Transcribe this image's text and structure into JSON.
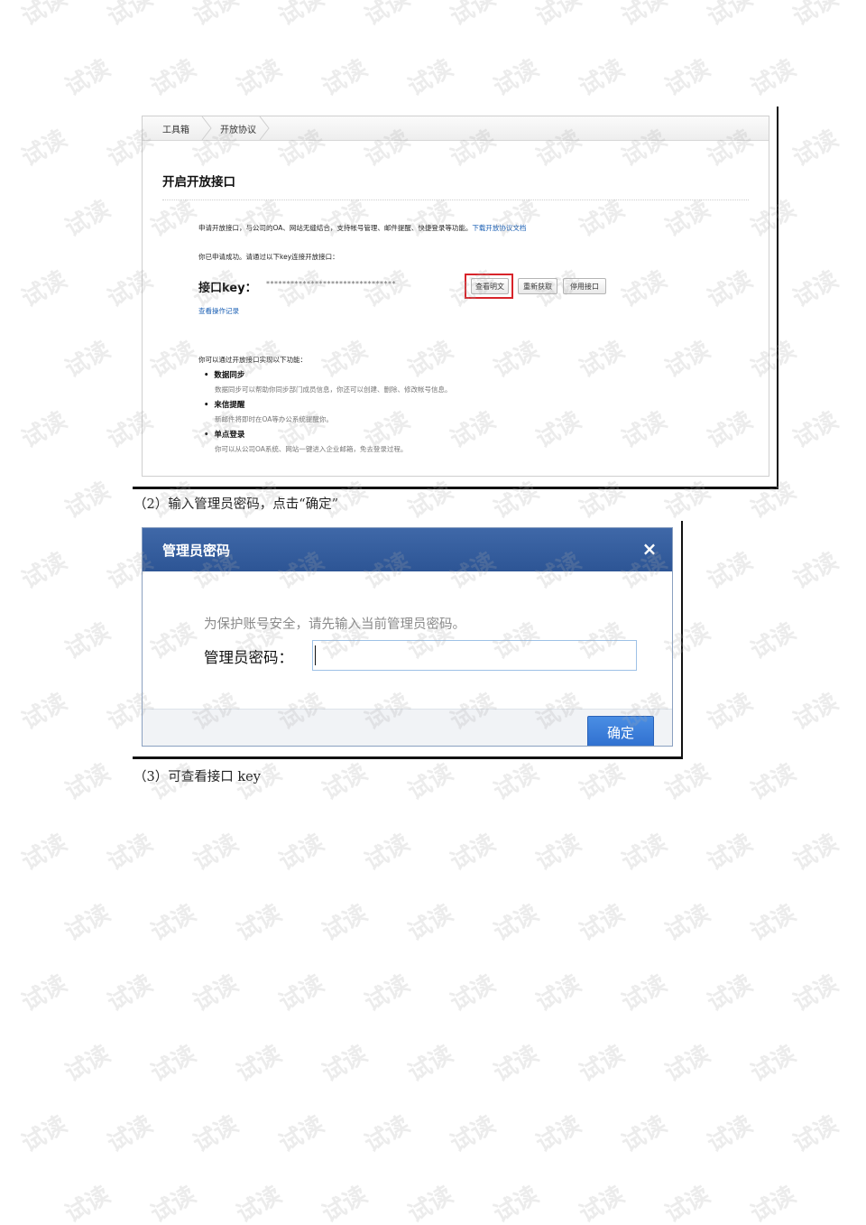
{
  "watermark": {
    "text": "试读"
  },
  "screenshot1": {
    "breadcrumb": [
      "工具箱",
      "开放协议"
    ],
    "title": "开启开放接口",
    "intro_text": "申请开放接口，与公司的OA、网站无缝结合，支持帐号管理、邮件提醒、快捷登录等功能。",
    "intro_link": "下载开放协议文档",
    "success_text": "你已申请成功。请通过以下key连接开放接口：",
    "key_label": "接口key：",
    "key_value": "********************************",
    "buttons": {
      "view_plain": "查看明文",
      "regenerate": "重新获取",
      "disable": "停用接口"
    },
    "history_link": "查看操作记录",
    "features_intro": "你可以通过开放接口实现以下功能：",
    "features": [
      {
        "name": "数据同步",
        "desc": "数据同步可以帮助你同步部门成员信息，你还可以创建、删除、修改帐号信息。"
      },
      {
        "name": "来信提醒",
        "desc": "新邮件将即时在OA等办公系统提醒你。"
      },
      {
        "name": "单点登录",
        "desc": "你可以从公司OA系统、网站一键进入企业邮箱，免去登录过程。"
      }
    ]
  },
  "caption2": "（2）输入管理员密码，点击“确定”",
  "dialog": {
    "title": "管理员密码",
    "close_symbol": "×",
    "hint": "为保护账号安全，请先输入当前管理员密码。",
    "label": "管理员密码：",
    "password_value": "",
    "ok_label": "确定"
  },
  "caption3": "（3）可查看接口 key",
  "colors": {
    "header_blue": "#2d5595",
    "button_blue": "#2f6fcf",
    "highlight_red": "#d8242a",
    "link_blue": "#1a5fb4"
  }
}
